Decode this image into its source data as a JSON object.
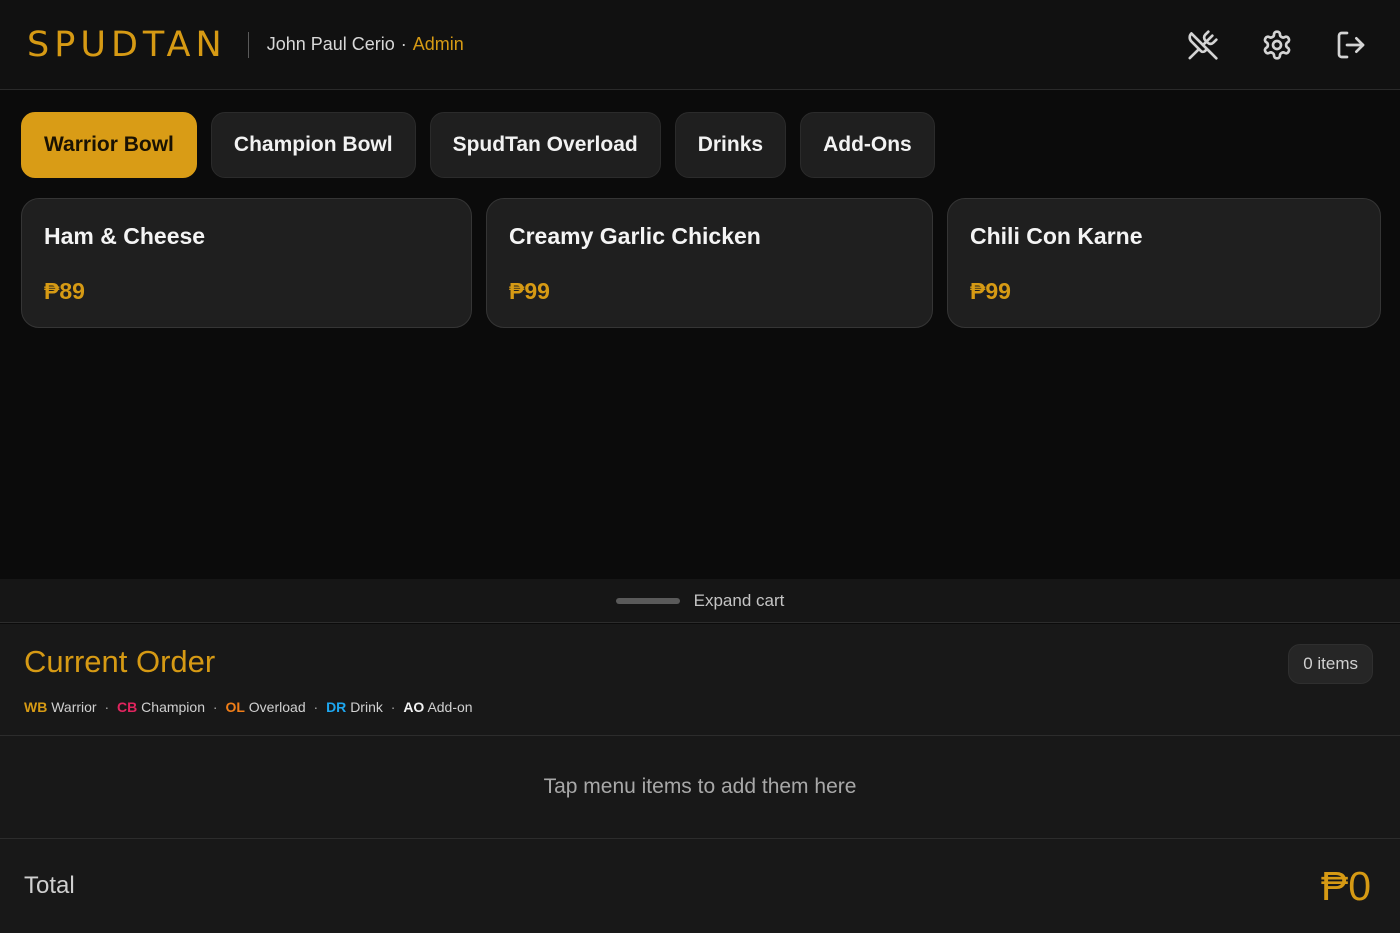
{
  "header": {
    "brand": "SPUDTAN",
    "user_name": "John Paul Cerio",
    "separator": "·",
    "role": "Admin",
    "actions": [
      {
        "icon": "utensils-crossed-icon"
      },
      {
        "icon": "gear-icon"
      },
      {
        "icon": "logout-icon"
      }
    ]
  },
  "tabs": [
    {
      "label": "Warrior Bowl",
      "active": true
    },
    {
      "label": "Champion Bowl",
      "active": false
    },
    {
      "label": "SpudTan Overload",
      "active": false
    },
    {
      "label": "Drinks",
      "active": false
    },
    {
      "label": "Add-Ons",
      "active": false
    }
  ],
  "menu_items": [
    {
      "name": "Ham & Cheese",
      "price": "₱89"
    },
    {
      "name": "Creamy Garlic Chicken",
      "price": "₱99"
    },
    {
      "name": "Chili Con Karne",
      "price": "₱99"
    }
  ],
  "expand": {
    "label": "Expand cart"
  },
  "cart": {
    "title": "Current Order",
    "items_badge": "0 items",
    "legend": [
      {
        "code": "WB",
        "label": "Warrior",
        "color": "#d69a14"
      },
      {
        "code": "CB",
        "label": "Champion",
        "color": "#e0245e"
      },
      {
        "code": "OL",
        "label": "Overload",
        "color": "#f07e18"
      },
      {
        "code": "DR",
        "label": "Drink",
        "color": "#1ea7f0"
      },
      {
        "code": "AO",
        "label": "Add-on",
        "color": "#f2f2f2"
      }
    ],
    "legend_separator": "·",
    "empty_message": "Tap menu items to add them here",
    "total_label": "Total",
    "total_value": "₱0"
  },
  "colors": {
    "accent": "#d69a14",
    "background": "#0b0b0b",
    "card": "#1f1f1f"
  }
}
